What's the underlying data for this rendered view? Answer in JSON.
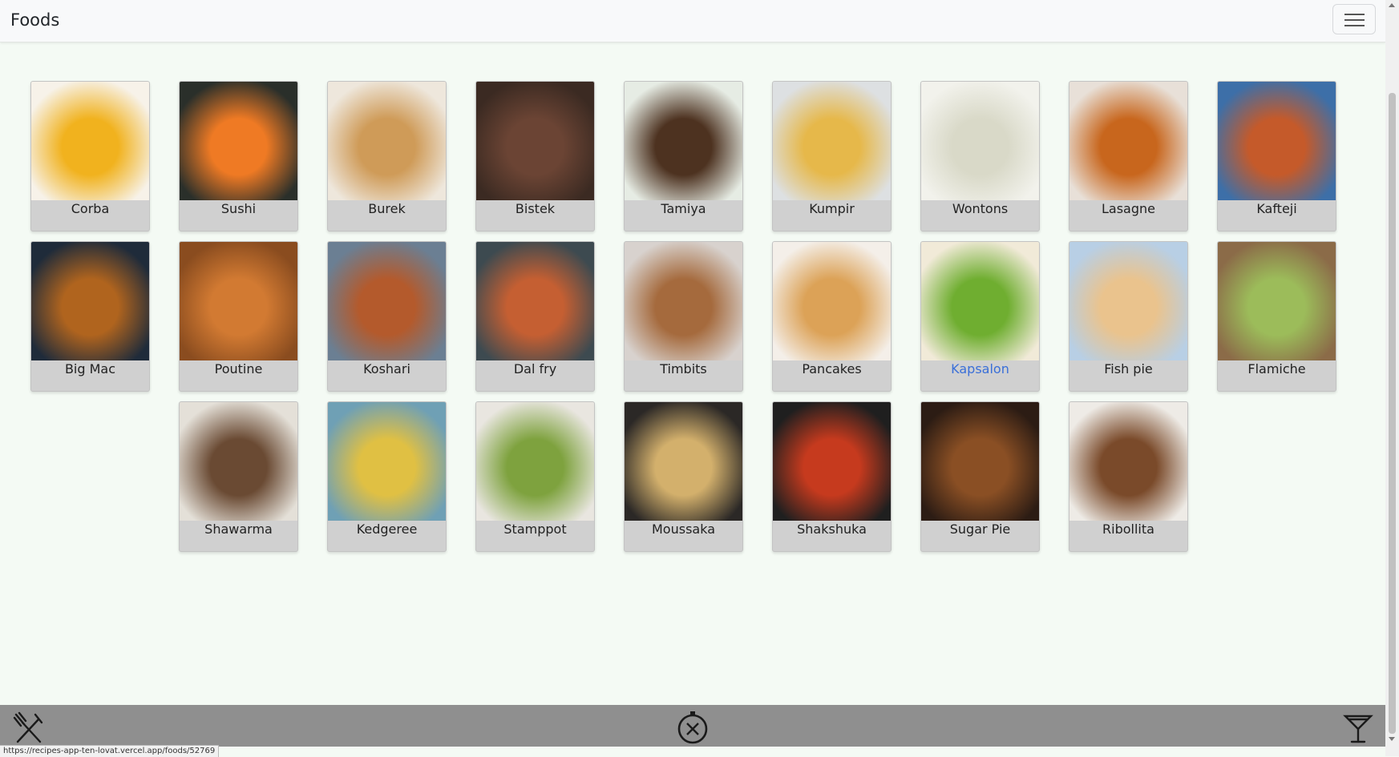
{
  "navbar": {
    "brand": "Foods"
  },
  "foods": [
    {
      "name": "Corba",
      "c1": "#f1b21e",
      "c2": "#f7f2e9"
    },
    {
      "name": "Sushi",
      "c1": "#ef7a24",
      "c2": "#2a2f2a"
    },
    {
      "name": "Burek",
      "c1": "#cf9b58",
      "c2": "#eee7dc"
    },
    {
      "name": "Bistek",
      "c1": "#6b4434",
      "c2": "#3b2a22"
    },
    {
      "name": "Tamiya",
      "c1": "#4d3220",
      "c2": "#e6ece4"
    },
    {
      "name": "Kumpir",
      "c1": "#e6b84a",
      "c2": "#dde0e2"
    },
    {
      "name": "Wontons",
      "c1": "#d9d9c8",
      "c2": "#f2f2ec"
    },
    {
      "name": "Lasagne",
      "c1": "#c8661d",
      "c2": "#e8e0d8"
    },
    {
      "name": "Kafteji",
      "c1": "#c55a2a",
      "c2": "#3d6fa8"
    },
    {
      "name": "Big Mac",
      "c1": "#b0641e",
      "c2": "#1f2b3a"
    },
    {
      "name": "Poutine",
      "c1": "#d27a32",
      "c2": "#8a4c1f"
    },
    {
      "name": "Koshari",
      "c1": "#b45a2c",
      "c2": "#6b7f93"
    },
    {
      "name": "Dal fry",
      "c1": "#c55f32",
      "c2": "#3d4a50"
    },
    {
      "name": "Timbits",
      "c1": "#a56a3d",
      "c2": "#d8d2ce"
    },
    {
      "name": "Pancakes",
      "c1": "#dca257",
      "c2": "#f4efe9"
    },
    {
      "name": "Kapsalon",
      "c1": "#6fae30",
      "c2": "#f1ead8"
    },
    {
      "name": "Fish pie",
      "c1": "#eac38d",
      "c2": "#b8cfe5"
    },
    {
      "name": "Flamiche",
      "c1": "#9cbc5a",
      "c2": "#8b6b48"
    },
    {
      "name": "Shawarma",
      "c1": "#6a4a33",
      "c2": "#e4e0d8"
    },
    {
      "name": "Kedgeree",
      "c1": "#e0c043",
      "c2": "#6fa0b5"
    },
    {
      "name": "Stamppot",
      "c1": "#7ea23e",
      "c2": "#e9e6e0"
    },
    {
      "name": "Moussaka",
      "c1": "#d3b06c",
      "c2": "#2b2826"
    },
    {
      "name": "Shakshuka",
      "c1": "#c63a1e",
      "c2": "#1f1f1f"
    },
    {
      "name": "Sugar Pie",
      "c1": "#8a4f24",
      "c2": "#2c1c14"
    },
    {
      "name": "Ribollita",
      "c1": "#7a4a2a",
      "c2": "#eeebe6"
    }
  ],
  "status_url": "https://recipes-app-ten-lovat.vercel.app/foods/52769",
  "colors": {
    "navbar_bg": "#f8f9fa",
    "footer_bg": "#8f8f8f",
    "hover_link": "#3a6fd8"
  },
  "icons": {
    "left": "fork-knife-icon",
    "center": "compass-icon",
    "right": "cocktail-icon"
  }
}
